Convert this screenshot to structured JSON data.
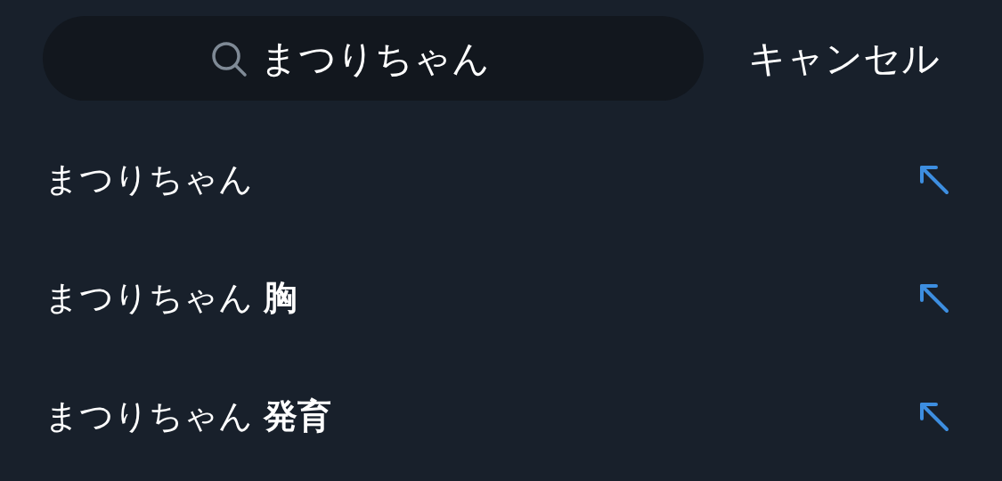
{
  "search": {
    "value": "まつりちゃん",
    "cancel": "キャンセル"
  },
  "suggestions": [
    {
      "text": "まつりちゃん"
    },
    {
      "text": "まつりちゃん **胸**"
    },
    {
      "text": "まつりちゃん **発育**"
    }
  ]
}
